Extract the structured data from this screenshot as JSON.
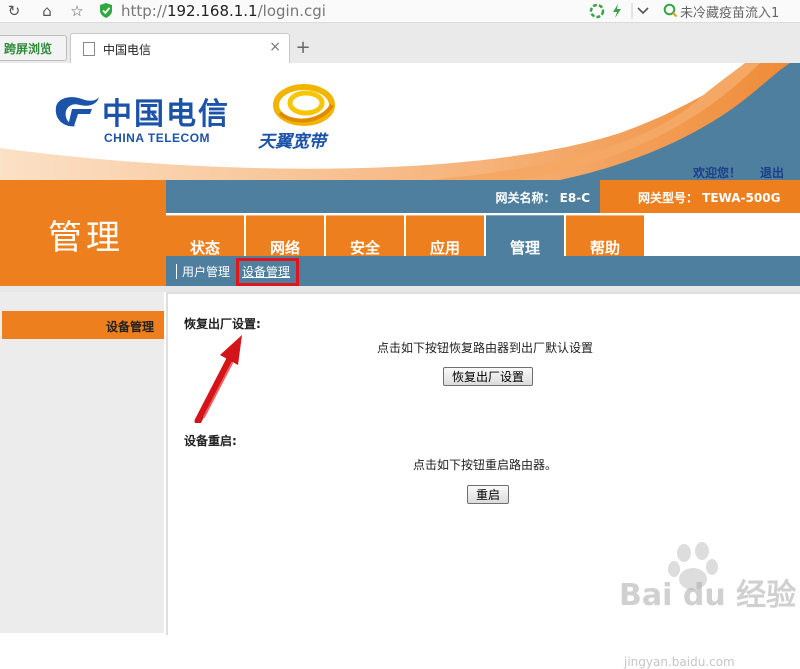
{
  "browser": {
    "url_prefix": "http://",
    "url_host": "192.168.1.1",
    "url_path": "/login.cgi",
    "search_text": "未冷藏疫苗流入1",
    "side_button": "跨屏浏览",
    "tab_title": "中国电信",
    "tab_close": "×",
    "new_tab": "+"
  },
  "header": {
    "brand_cn": "中国电信",
    "brand_en": "CHINA TELECOM",
    "product": "天翼宽带",
    "welcome": "欢迎您！",
    "logout": "退出",
    "section_title": "管理",
    "gateway_name": "网关名称：  E8-C",
    "gateway_model": "网关型号：  TEWA-500G"
  },
  "menu": {
    "tabs": [
      {
        "label": "状态"
      },
      {
        "label": "网络"
      },
      {
        "label": "安全"
      },
      {
        "label": "应用"
      },
      {
        "label": "管理"
      },
      {
        "label": "帮助"
      }
    ],
    "active": "管理"
  },
  "submenu": {
    "items": [
      {
        "label": "用户管理"
      },
      {
        "label": "设备管理"
      }
    ]
  },
  "sidebar": {
    "item": "设备管理"
  },
  "content": {
    "restore": {
      "title": "恢复出厂设置:",
      "desc": "点击如下按钮恢复路由器到出厂默认设置",
      "button": "恢复出厂设置"
    },
    "reboot": {
      "title": "设备重启:",
      "desc": "点击如下按钮重启路由器。",
      "button": "重启"
    }
  },
  "watermark": {
    "brand": "Bai du 经验",
    "url": "jingyan.baidu.com"
  },
  "colors": {
    "orange": "#ee7f1e",
    "steel_blue": "#4e7f9f",
    "telecom_blue": "#1c53a8",
    "highlight_red": "#e0161b"
  }
}
